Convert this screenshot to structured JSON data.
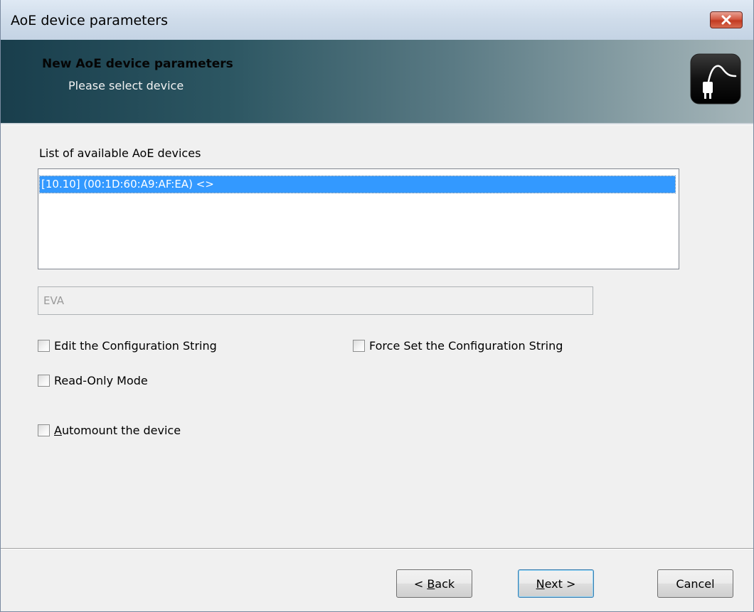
{
  "window": {
    "title": "AoE device parameters"
  },
  "header": {
    "title": "New AoE device parameters",
    "subtitle": "Please select device",
    "icon": "plug-cable-icon"
  },
  "device_list": {
    "label": "List of available AoE devices",
    "items": [
      "[10.10] (00:1D:60:A9:AF:EA) <>"
    ],
    "selected_index": 0
  },
  "name_field": {
    "value": "EVA",
    "disabled": true
  },
  "options": {
    "edit_config": {
      "label": "Edit the Configuration String",
      "checked": false
    },
    "force_config": {
      "label": "Force Set the Configuration String",
      "checked": false
    },
    "read_only": {
      "label": "Read-Only Mode",
      "checked": false
    },
    "automount": {
      "label_access": "A",
      "label_rest": "utomount the device",
      "checked": false
    }
  },
  "buttons": {
    "back_prefix": "< ",
    "back_access": "B",
    "back_rest": "ack",
    "next_access": "N",
    "next_rest": "ext >",
    "cancel": "Cancel"
  },
  "colors": {
    "selection": "#3399ff",
    "header_dark": "#193e4c",
    "header_light": "#a6b6ba"
  }
}
